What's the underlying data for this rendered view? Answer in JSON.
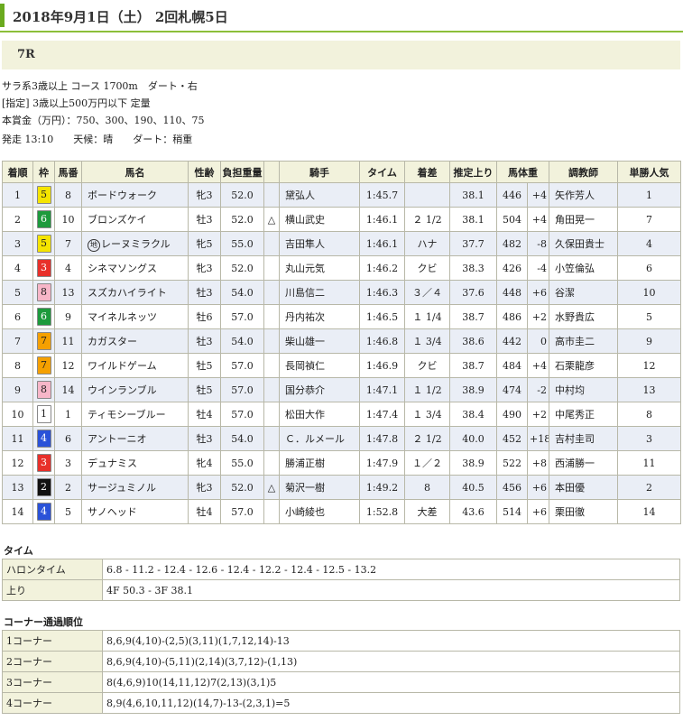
{
  "header": {
    "title": "2018年9月1日（土） 2回札幌5日"
  },
  "race": {
    "number": "7R"
  },
  "info": {
    "line1": "サラ系3歳以上 コース 1700m　ダート・右",
    "line2": "[指定] 3歳以上500万円以下 定量",
    "line3": "本賞金（万円）：750、300、190、110、75",
    "line4": "発走 13:10　　天候：晴　　ダート：稍重"
  },
  "table": {
    "headers": [
      "着順",
      "枠",
      "馬番",
      "馬名",
      "性齢",
      "負担重量",
      "",
      "騎手",
      "タイム",
      "着差",
      "推定上り",
      "馬体重",
      "",
      "調教師",
      "単勝人気"
    ],
    "rows": [
      {
        "rank": "1",
        "waku": "5",
        "uma": "8",
        "name": "ボードウォーク",
        "sex": "牝3",
        "weight": "52.0",
        "mark": "",
        "jockey": "黛弘人",
        "time": "1:45.7",
        "margin": "",
        "last": "38.1",
        "bw": "446",
        "diff": "+4",
        "trainer": "矢作芳人",
        "pop": "1",
        "chichi": false
      },
      {
        "rank": "2",
        "waku": "6",
        "uma": "10",
        "name": "ブロンズケイ",
        "sex": "牡3",
        "weight": "52.0",
        "mark": "△",
        "jockey": "横山武史",
        "time": "1:46.1",
        "margin": "２ 1/2",
        "last": "38.1",
        "bw": "504",
        "diff": "+4",
        "trainer": "角田晃一",
        "pop": "7",
        "chichi": false
      },
      {
        "rank": "3",
        "waku": "5",
        "uma": "7",
        "name": "レーヌミラクル",
        "sex": "牝5",
        "weight": "55.0",
        "mark": "",
        "jockey": "吉田隼人",
        "time": "1:46.1",
        "margin": "ハナ",
        "last": "37.7",
        "bw": "482",
        "diff": "-8",
        "trainer": "久保田貴士",
        "pop": "4",
        "chichi": true
      },
      {
        "rank": "4",
        "waku": "3",
        "uma": "4",
        "name": "シネマソングス",
        "sex": "牝3",
        "weight": "52.0",
        "mark": "",
        "jockey": "丸山元気",
        "time": "1:46.2",
        "margin": "クビ",
        "last": "38.3",
        "bw": "426",
        "diff": "-4",
        "trainer": "小笠倫弘",
        "pop": "6",
        "chichi": false
      },
      {
        "rank": "5",
        "waku": "8",
        "uma": "13",
        "name": "スズカハイライト",
        "sex": "牡3",
        "weight": "54.0",
        "mark": "",
        "jockey": "川島信二",
        "time": "1:46.3",
        "margin": "３／４",
        "last": "37.6",
        "bw": "448",
        "diff": "+6",
        "trainer": "谷潔",
        "pop": "10",
        "chichi": false
      },
      {
        "rank": "6",
        "waku": "6",
        "uma": "9",
        "name": "マイネルネッツ",
        "sex": "牡6",
        "weight": "57.0",
        "mark": "",
        "jockey": "丹内祐次",
        "time": "1:46.5",
        "margin": "１ 1/4",
        "last": "38.7",
        "bw": "486",
        "diff": "+2",
        "trainer": "水野貴広",
        "pop": "5",
        "chichi": false
      },
      {
        "rank": "7",
        "waku": "7",
        "uma": "11",
        "name": "カガスター",
        "sex": "牡3",
        "weight": "54.0",
        "mark": "",
        "jockey": "柴山雄一",
        "time": "1:46.8",
        "margin": "１ 3/4",
        "last": "38.6",
        "bw": "442",
        "diff": "0",
        "trainer": "高市圭二",
        "pop": "9",
        "chichi": false
      },
      {
        "rank": "8",
        "waku": "7",
        "uma": "12",
        "name": "ワイルドゲーム",
        "sex": "牡5",
        "weight": "57.0",
        "mark": "",
        "jockey": "長岡禎仁",
        "time": "1:46.9",
        "margin": "クビ",
        "last": "38.7",
        "bw": "484",
        "diff": "+4",
        "trainer": "石栗龍彦",
        "pop": "12",
        "chichi": false
      },
      {
        "rank": "9",
        "waku": "8",
        "uma": "14",
        "name": "ウインランブル",
        "sex": "牡5",
        "weight": "57.0",
        "mark": "",
        "jockey": "国分恭介",
        "time": "1:47.1",
        "margin": "１ 1/2",
        "last": "38.9",
        "bw": "474",
        "diff": "-2",
        "trainer": "中村均",
        "pop": "13",
        "chichi": false
      },
      {
        "rank": "10",
        "waku": "1",
        "uma": "1",
        "name": "ティモシーブルー",
        "sex": "牡4",
        "weight": "57.0",
        "mark": "",
        "jockey": "松田大作",
        "time": "1:47.4",
        "margin": "１ 3/4",
        "last": "38.4",
        "bw": "490",
        "diff": "+2",
        "trainer": "中尾秀正",
        "pop": "8",
        "chichi": false
      },
      {
        "rank": "11",
        "waku": "4",
        "uma": "6",
        "name": "アントーニオ",
        "sex": "牡3",
        "weight": "54.0",
        "mark": "",
        "jockey": "Ｃ．ルメール",
        "time": "1:47.8",
        "margin": "２ 1/2",
        "last": "40.0",
        "bw": "452",
        "diff": "+18",
        "trainer": "吉村圭司",
        "pop": "3",
        "chichi": false
      },
      {
        "rank": "12",
        "waku": "3",
        "uma": "3",
        "name": "デュナミス",
        "sex": "牝4",
        "weight": "55.0",
        "mark": "",
        "jockey": "勝浦正樹",
        "time": "1:47.9",
        "margin": "１／２",
        "last": "38.9",
        "bw": "522",
        "diff": "+8",
        "trainer": "西浦勝一",
        "pop": "11",
        "chichi": false
      },
      {
        "rank": "13",
        "waku": "2",
        "uma": "2",
        "name": "サージュミノル",
        "sex": "牝3",
        "weight": "52.0",
        "mark": "△",
        "jockey": "菊沢一樹",
        "time": "1:49.2",
        "margin": "8",
        "last": "40.5",
        "bw": "456",
        "diff": "+6",
        "trainer": "本田優",
        "pop": "2",
        "chichi": false
      },
      {
        "rank": "14",
        "waku": "4",
        "uma": "5",
        "name": "サノヘッド",
        "sex": "牡4",
        "weight": "57.0",
        "mark": "",
        "jockey": "小崎綾也",
        "time": "1:52.8",
        "margin": "大差",
        "last": "43.6",
        "bw": "514",
        "diff": "+6",
        "trainer": "栗田徹",
        "pop": "14",
        "chichi": false
      }
    ]
  },
  "waku_colors": {
    "1": {
      "bg": "#ffffff",
      "fg": "#222222"
    },
    "2": {
      "bg": "#111111",
      "fg": "#ffffff"
    },
    "3": {
      "bg": "#e8302a",
      "fg": "#ffffff"
    },
    "4": {
      "bg": "#2a52d8",
      "fg": "#ffffff"
    },
    "5": {
      "bg": "#f5e400",
      "fg": "#222222"
    },
    "6": {
      "bg": "#1d9a3c",
      "fg": "#ffffff"
    },
    "7": {
      "bg": "#f5a000",
      "fg": "#222222"
    },
    "8": {
      "bg": "#f7b6c8",
      "fg": "#222222"
    }
  },
  "chichi_mark": "地",
  "time_section": {
    "title": "タイム",
    "rows": [
      {
        "label": "ハロンタイム",
        "value": "6.8 - 11.2 - 12.4 - 12.6 - 12.4 - 12.2 - 12.4 - 12.5 - 13.2"
      },
      {
        "label": "上り",
        "value": "4F 50.3 - 3F 38.1"
      }
    ]
  },
  "corner_section": {
    "title": "コーナー通過順位",
    "rows": [
      {
        "label": "1コーナー",
        "value": "8,6,9(4,10)-(2,5)(3,11)(1,7,12,14)-13"
      },
      {
        "label": "2コーナー",
        "value": "8,6,9(4,10)-(5,11)(2,14)(3,7,12)-(1,13)"
      },
      {
        "label": "3コーナー",
        "value": "8(4,6,9)10(14,11,12)7(2,13)(3,1)5"
      },
      {
        "label": "4コーナー",
        "value": "8,9(4,6,10,11,12)(14,7)-13-(2,3,1)=5"
      }
    ]
  }
}
